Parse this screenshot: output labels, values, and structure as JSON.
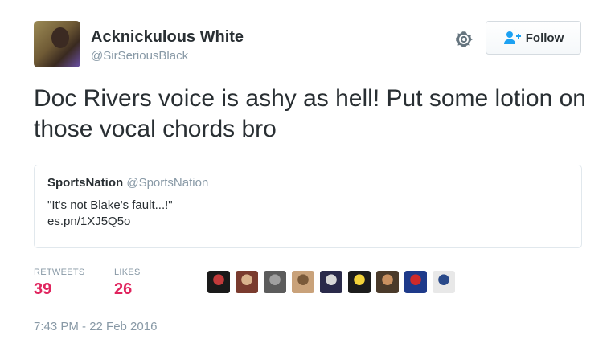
{
  "author": {
    "name": "Acknickulous White",
    "handle": "@SirSeriousBlack"
  },
  "follow_button": {
    "label": "Follow",
    "icon": "add-user-icon"
  },
  "tweet": {
    "text": "Doc Rivers voice is ashy as hell! Put some lotion on those vocal chords bro"
  },
  "quoted_tweet": {
    "name": "SportsNation",
    "handle": "@SportsNation",
    "text": "\"It's not Blake's fault...!\"",
    "link": "es.pn/1XJ5Q5o"
  },
  "stats": {
    "retweets_label": "RETWEETS",
    "retweets_value": "39",
    "likes_label": "LIKES",
    "likes_value": "26"
  },
  "timestamp": "7:43 PM - 22 Feb 2016",
  "colors": {
    "stat_value": "#e0245e",
    "muted": "#8899a6",
    "text": "#292f33",
    "border": "#e1e8ed"
  },
  "likers": [
    {
      "bg": "#1a1a1a",
      "fg": "#c23a3a"
    },
    {
      "bg": "#7a3b2e",
      "fg": "#d9b28c"
    },
    {
      "bg": "#5c5c5c",
      "fg": "#a0a0a0"
    },
    {
      "bg": "#c9a27a",
      "fg": "#7a5a3a"
    },
    {
      "bg": "#2a2a4a",
      "fg": "#d8d8d8"
    },
    {
      "bg": "#1c1c1c",
      "fg": "#f2d23a"
    },
    {
      "bg": "#4a3a2a",
      "fg": "#c89060"
    },
    {
      "bg": "#1e3a8a",
      "fg": "#cf2a2a"
    },
    {
      "bg": "#e8e8e8",
      "fg": "#2a4a8a"
    }
  ]
}
